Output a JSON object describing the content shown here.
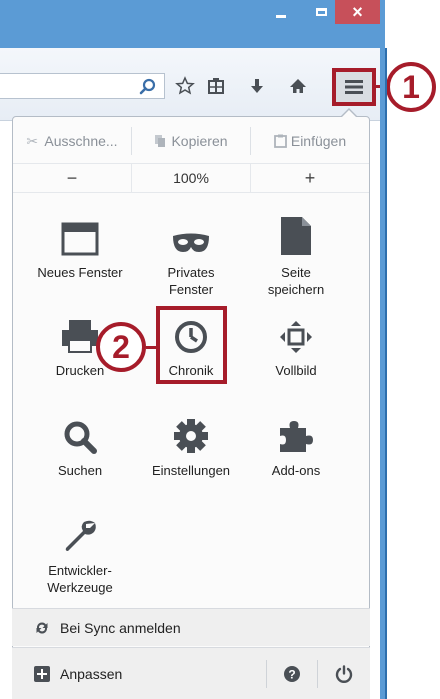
{
  "window": {
    "minimize_icon": "minimize-icon",
    "maximize_icon": "maximize-icon",
    "close_symbol": "×"
  },
  "toolbar": {
    "search_icon": "magnifier-icon",
    "icons": [
      "star-icon",
      "reading-list-icon",
      "download-icon",
      "home-icon",
      "hamburger-menu-icon"
    ]
  },
  "callouts": {
    "one": "1",
    "two": "2"
  },
  "menu": {
    "edit": {
      "cut": "Ausschne...",
      "copy": "Kopieren",
      "paste": "Einfügen"
    },
    "zoom": {
      "minus": "−",
      "level": "100%",
      "plus": "+"
    },
    "tiles": [
      {
        "label": "Neues Fenster",
        "icon": "window-icon"
      },
      {
        "label": "Privates\nFenster",
        "icon": "mask-icon"
      },
      {
        "label": "Seite\nspeichern",
        "icon": "page-icon"
      },
      {
        "label": "Drucken",
        "icon": "printer-icon"
      },
      {
        "label": "Chronik",
        "icon": "clock-icon"
      },
      {
        "label": "Vollbild",
        "icon": "fullscreen-icon"
      },
      {
        "label": "Suchen",
        "icon": "search-icon"
      },
      {
        "label": "Einstellungen",
        "icon": "gear-icon"
      },
      {
        "label": "Add-ons",
        "icon": "puzzle-icon"
      },
      {
        "label": "Entwickler-\nWerkzeuge",
        "icon": "wrench-icon"
      }
    ],
    "sync_label": "Bei Sync anmelden",
    "customize_label": "Anpassen",
    "help_icon": "help-icon",
    "quit_icon": "power-icon"
  },
  "colors": {
    "accent_red": "#a61c2a",
    "titlebar_blue": "#5b9bd5",
    "icon_gray": "#4a4f55"
  }
}
